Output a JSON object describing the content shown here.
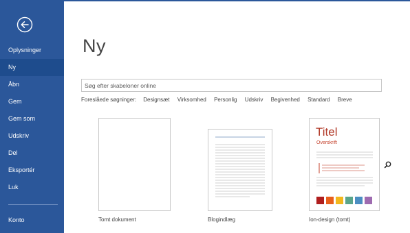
{
  "sidebar": {
    "back_icon": "back-arrow-icon",
    "items": [
      {
        "label": "Oplysninger"
      },
      {
        "label": "Ny"
      },
      {
        "label": "Åbn"
      },
      {
        "label": "Gem"
      },
      {
        "label": "Gem som"
      },
      {
        "label": "Udskriv"
      },
      {
        "label": "Del"
      },
      {
        "label": "Eksportér"
      },
      {
        "label": "Luk"
      }
    ],
    "account_label": "Konto",
    "active_index": 1,
    "color": "#2b579a",
    "active_color": "#1e4c8d"
  },
  "main": {
    "title": "Ny",
    "search": {
      "placeholder": "Søg efter skabeloner online",
      "icon": "search-icon"
    },
    "suggested": {
      "label": "Foreslåede søgninger:",
      "items": [
        "Designsæt",
        "Virksomhed",
        "Personlig",
        "Udskriv",
        "Begivenhed",
        "Standard",
        "Breve"
      ]
    },
    "templates": [
      {
        "label": "Tomt dokument"
      },
      {
        "label": "Blogindlæg"
      },
      {
        "label": "Ion-design (tomt)",
        "heading": "Titel",
        "subheading": "Overskrift",
        "swatches": [
          "#b01e1e",
          "#e8601c",
          "#f2b81e",
          "#5aa58c",
          "#4c8ec2",
          "#9e6bb0"
        ]
      }
    ]
  }
}
